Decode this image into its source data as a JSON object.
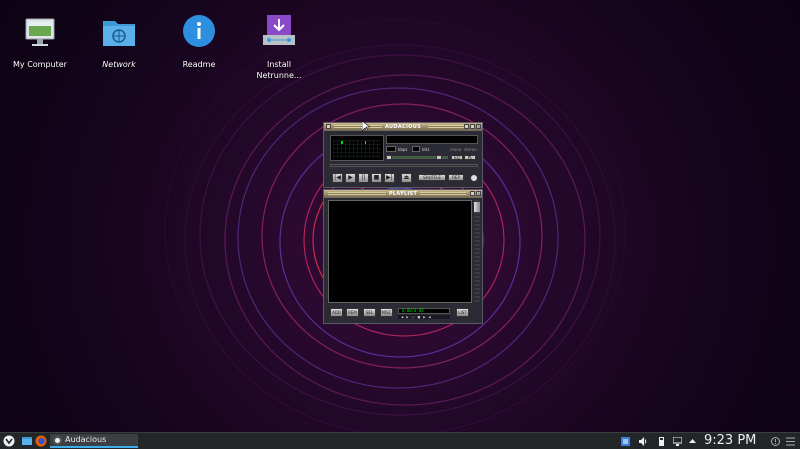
{
  "desktop": {
    "icons": [
      {
        "name": "my-computer",
        "label": "My Computer",
        "italic": false
      },
      {
        "name": "network",
        "label": "Network",
        "italic": true
      },
      {
        "name": "readme",
        "label": "Readme",
        "italic": false
      },
      {
        "name": "install",
        "label": "Install\nNetrunne...",
        "italic": false
      }
    ]
  },
  "player": {
    "title": "AUDACIOUS",
    "kbps_label": "kbps",
    "khz_label": "kHz",
    "mono_label": "mono",
    "stereo_label": "stereo",
    "eq_label": "EQ",
    "pl_label": "PL",
    "shuffle_label": "SHUFFLE",
    "repeat_label": "REP",
    "controls": [
      "|◀",
      "▶",
      "||",
      "■",
      "▶|",
      "⏏"
    ]
  },
  "playlist": {
    "title": "PLAYLIST",
    "buttons": [
      "ADD",
      "REM",
      "SEL",
      "MISC"
    ],
    "list_button": "LIST",
    "time": "0:00/0:00",
    "mini_controls": "◀ ▶ || ■ ▶ ⏏"
  },
  "taskbar": {
    "task_label": "Audacious",
    "clock": "9:23 PM",
    "accent": "#3daee9"
  }
}
